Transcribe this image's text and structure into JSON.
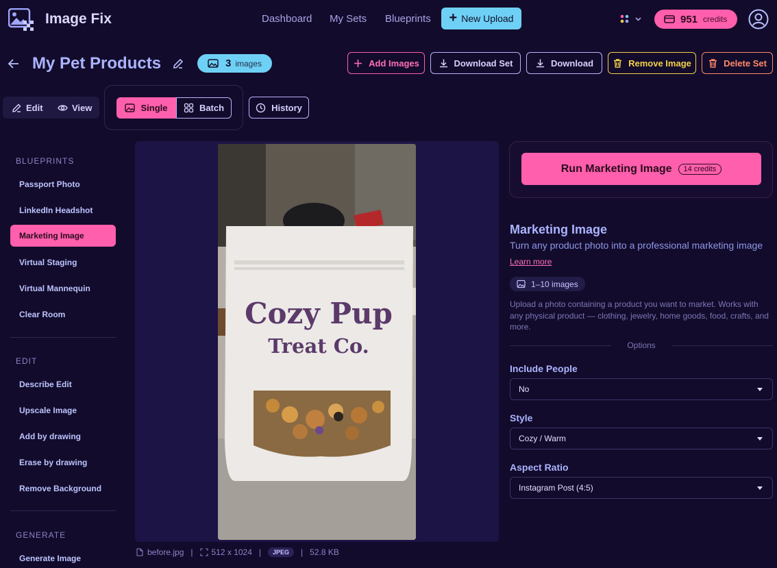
{
  "app": {
    "name": "Image Fix"
  },
  "nav": {
    "links": [
      "Dashboard",
      "My Sets",
      "Blueprints"
    ],
    "new_upload": "New Upload",
    "credits_value": "951",
    "credits_label": "credits"
  },
  "set": {
    "title": "My Pet Products",
    "image_count": "3",
    "image_count_label": "images"
  },
  "actions": {
    "add_images": "Add Images",
    "download_set": "Download Set",
    "download": "Download",
    "remove_image": "Remove Image",
    "delete_set": "Delete Set"
  },
  "modes": {
    "edit": "Edit",
    "view": "View",
    "single": "Single",
    "batch": "Batch",
    "history": "History"
  },
  "sidebar": {
    "sections": [
      {
        "title": "BLUEPRINTS",
        "items": [
          "Passport Photo",
          "LinkedIn Headshot",
          "Marketing Image",
          "Virtual Staging",
          "Virtual Mannequin",
          "Clear Room"
        ],
        "active": "Marketing Image"
      },
      {
        "title": "EDIT",
        "items": [
          "Describe Edit",
          "Upscale Image",
          "Add by drawing",
          "Erase by drawing",
          "Remove Background"
        ]
      },
      {
        "title": "GENERATE",
        "items": [
          "Generate Image"
        ]
      }
    ]
  },
  "image": {
    "product_text_line1": "Cozy Pup",
    "product_text_line2": "Treat Co.",
    "filename": "before.jpg",
    "dimensions": "512 x 1024",
    "format": "JPEG",
    "size": "52.8 KB"
  },
  "blueprint": {
    "run_label": "Run Marketing Image",
    "run_cost": "14 credits",
    "title": "Marketing Image",
    "description": "Turn any product photo into a professional marketing image",
    "learn_more": "Learn more",
    "image_range": "1–10 images",
    "help": "Upload a photo containing a product you want to market. Works with any physical product — clothing, jewelry, home goods, food, crafts, and more.",
    "options_label": "Options",
    "fields": [
      {
        "label": "Include People",
        "value": "No"
      },
      {
        "label": "Style",
        "value": "Cozy / Warm"
      },
      {
        "label": "Aspect Ratio",
        "value": "Instagram Post (4:5)"
      }
    ]
  },
  "colors": {
    "background": "#130b2b",
    "accent_pink": "#ff5fac",
    "accent_cyan": "#6fd0f5",
    "warning_yellow": "#f5d24a",
    "danger_orange": "#ff8a6a"
  }
}
